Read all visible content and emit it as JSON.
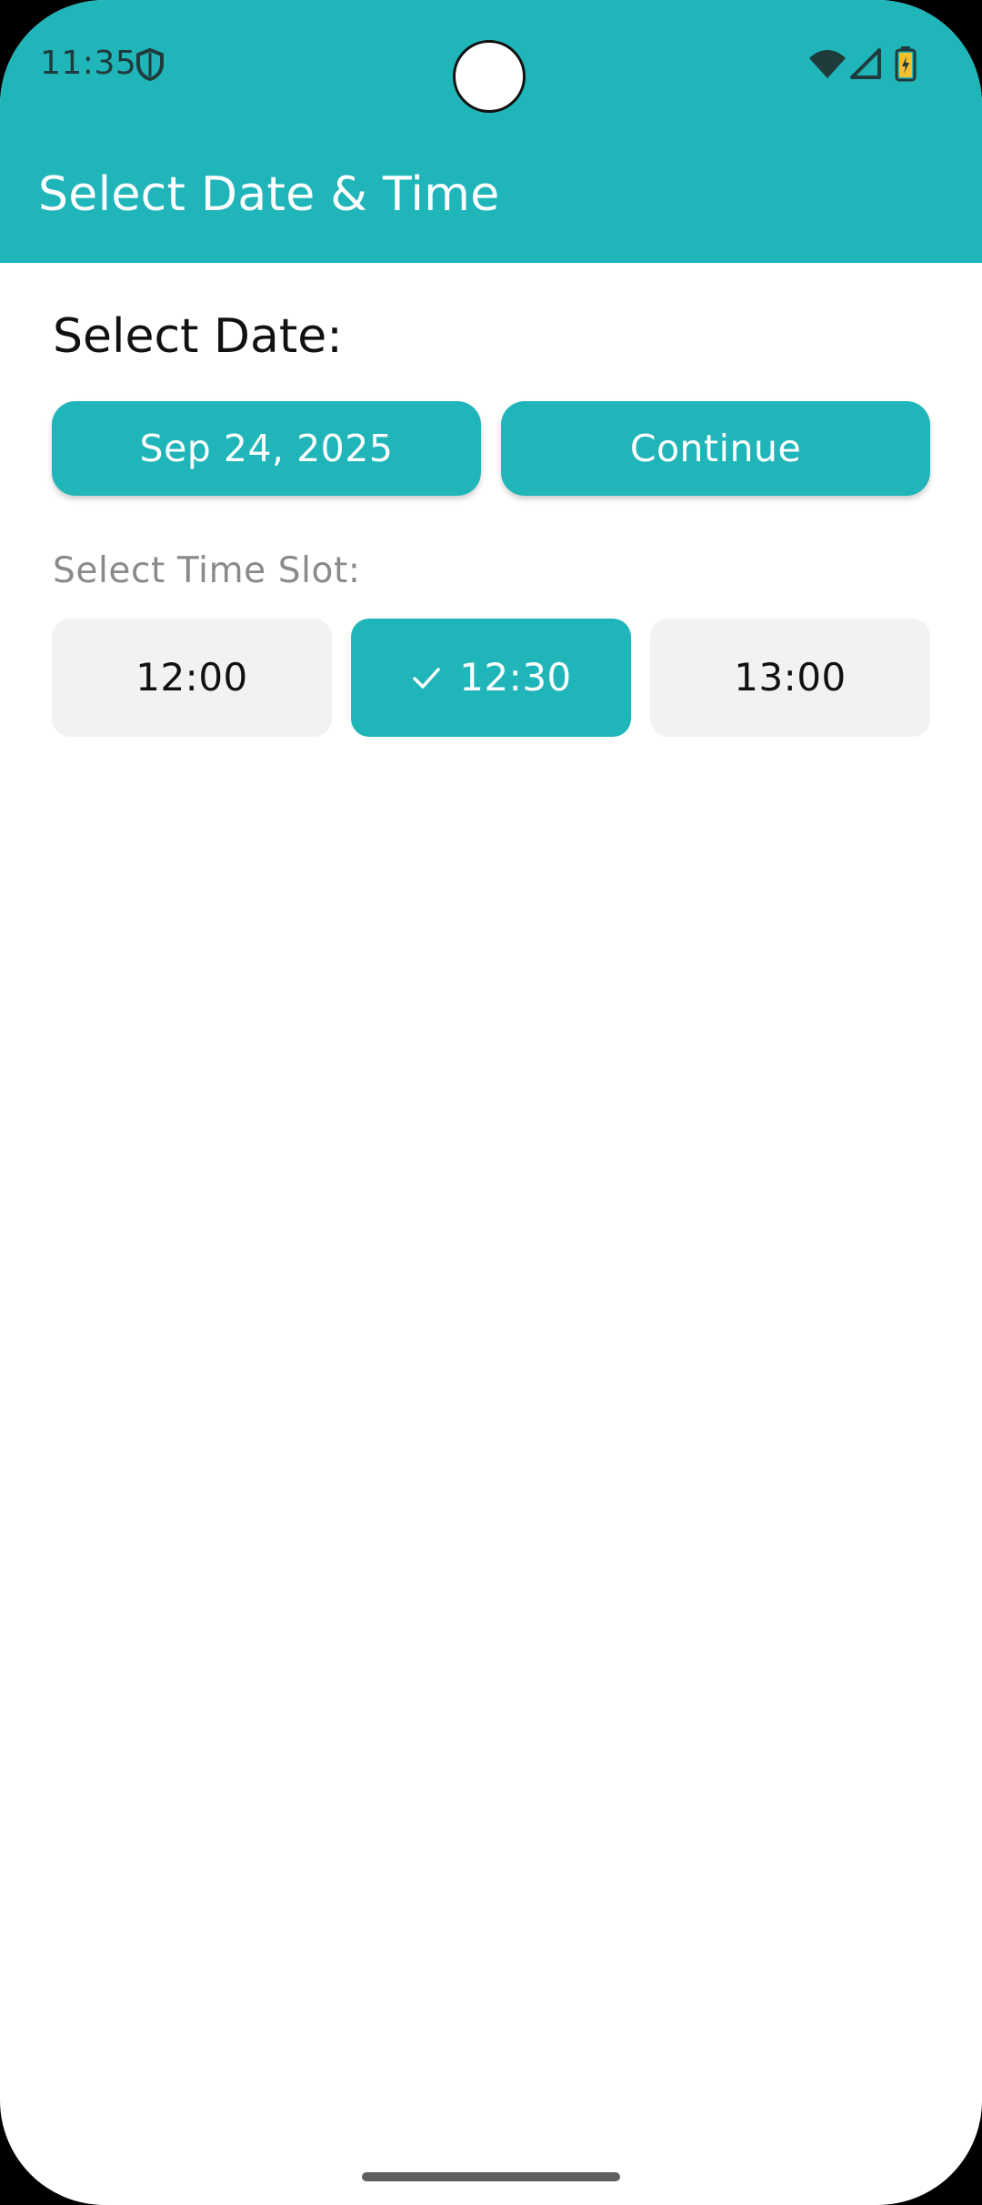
{
  "status_bar": {
    "time": "11:35",
    "left_icons": [
      "shield-icon"
    ],
    "right_icons": [
      "wifi-icon",
      "signal-icon",
      "battery-icon"
    ]
  },
  "app_bar": {
    "title": "Select Date & Time"
  },
  "content": {
    "date_heading": "Select Date:",
    "date_button_label": "Sep 24, 2025",
    "continue_button_label": "Continue",
    "time_heading": "Select Time Slot:",
    "time_slots": [
      {
        "label": "12:00",
        "selected": false
      },
      {
        "label": "12:30",
        "selected": true,
        "icon": "check-icon"
      },
      {
        "label": "13:00",
        "selected": false
      }
    ]
  },
  "colors": {
    "accent": "#20b5b9",
    "slot_background": "#f2f2f2",
    "muted_text": "#8a8a8a"
  }
}
